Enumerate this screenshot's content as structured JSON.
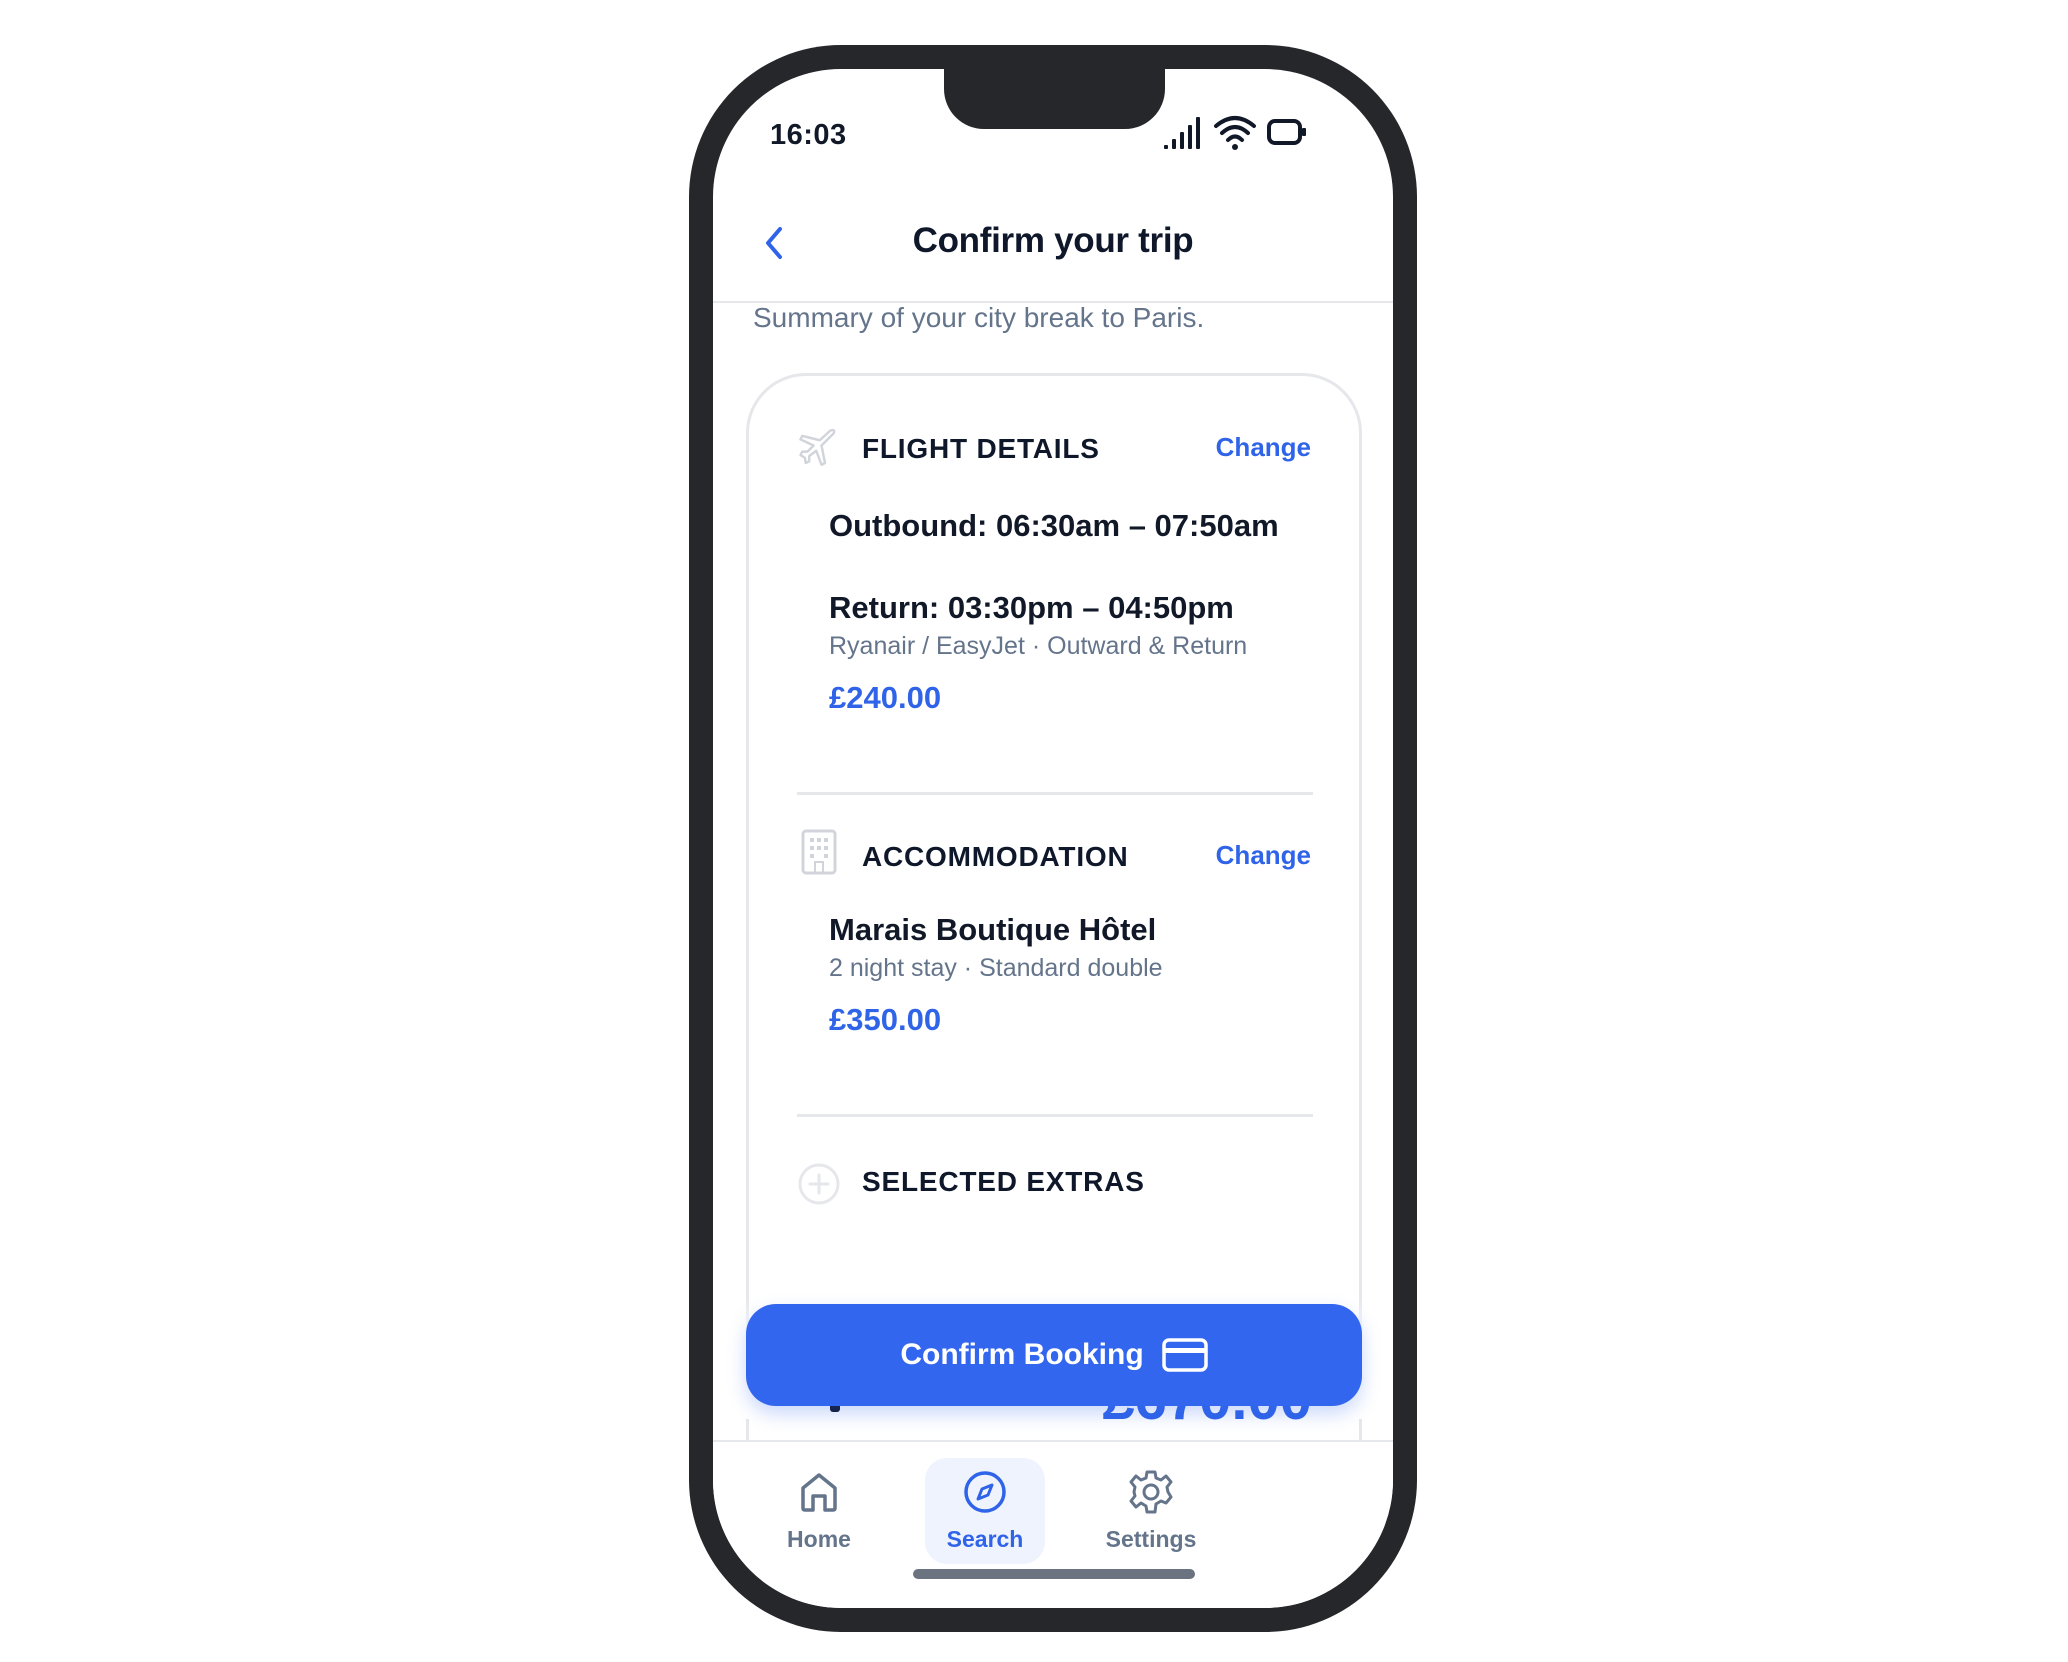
{
  "status_bar": {
    "time": "16:03"
  },
  "header": {
    "title": "Confirm your trip"
  },
  "summary": "Summary of your city break to Paris.",
  "flight": {
    "title": "FLIGHT DETAILS",
    "change_label": "Change",
    "outbound": "Outbound: 06:30am – 07:50am",
    "return": "Return: 03:30pm – 04:50pm",
    "airlines": "Ryanair / EasyJet · Outward & Return",
    "price": "£240.00"
  },
  "accommodation": {
    "title": "ACCOMMODATION",
    "change_label": "Change",
    "hotel": "Marais Boutique Hôtel",
    "details": "2 night stay · Standard double",
    "price": "£350.00"
  },
  "extras": {
    "title": "SELECTED EXTRAS"
  },
  "total": {
    "amount": "£670.00"
  },
  "cta": {
    "label": "Confirm Booking"
  },
  "nav": {
    "items": [
      {
        "label": "Home",
        "icon": "home-icon"
      },
      {
        "label": "Search",
        "icon": "compass-icon",
        "active": true
      },
      {
        "label": "Settings",
        "icon": "gear-icon"
      }
    ]
  },
  "colors": {
    "accent": "#3366ee",
    "text": "#0f172a",
    "muted": "#64748b"
  }
}
